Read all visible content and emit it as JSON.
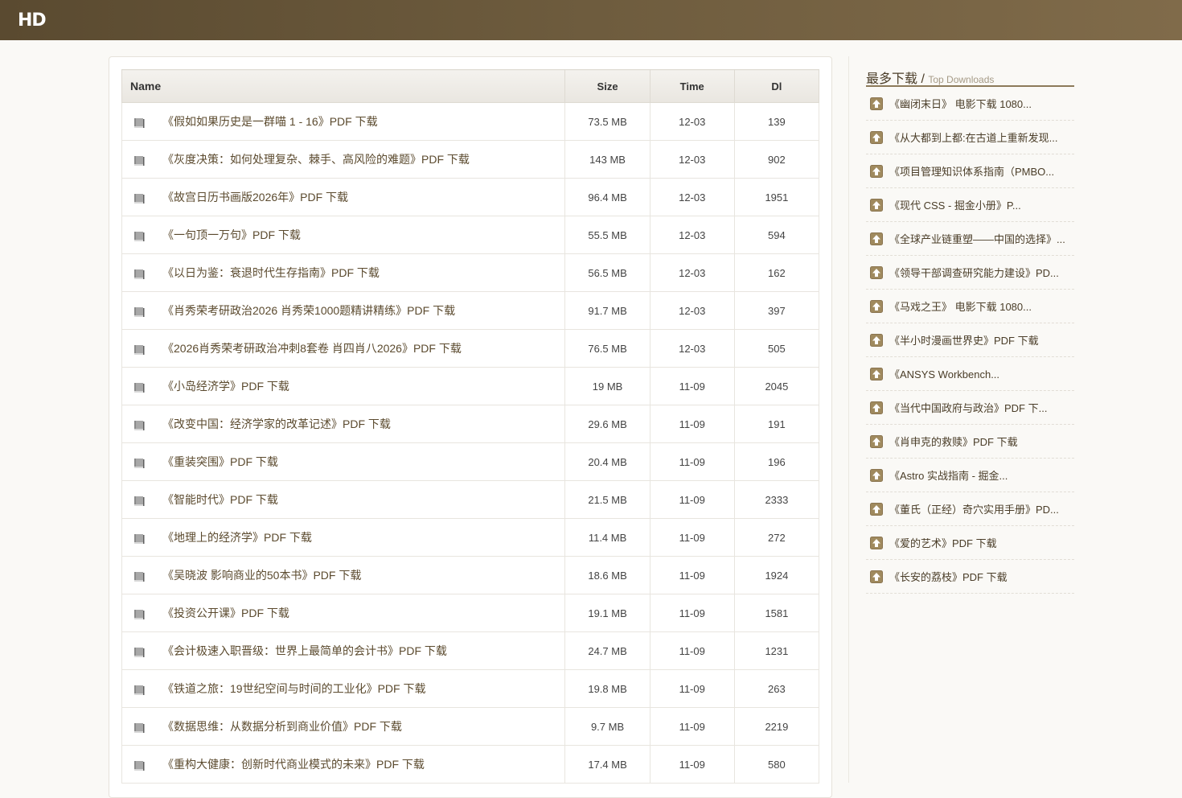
{
  "header": {
    "logo": "HD"
  },
  "table": {
    "columns": {
      "name": "Name",
      "size": "Size",
      "time": "Time",
      "dl": "Dl"
    },
    "rows": [
      {
        "name": "《假如如果历史是一群喵 1 - 16》PDF 下载",
        "size": "73.5 MB",
        "time": "12-03",
        "dl": "139"
      },
      {
        "name": "《灰度决策：如何处理复杂、棘手、高风险的难题》PDF 下载",
        "size": "143 MB",
        "time": "12-03",
        "dl": "902"
      },
      {
        "name": "《故宫日历书画版2026年》PDF 下载",
        "size": "96.4 MB",
        "time": "12-03",
        "dl": "1951"
      },
      {
        "name": "《一句顶一万句》PDF 下载",
        "size": "55.5 MB",
        "time": "12-03",
        "dl": "594"
      },
      {
        "name": "《以日为鉴：衰退时代生存指南》PDF 下载",
        "size": "56.5 MB",
        "time": "12-03",
        "dl": "162"
      },
      {
        "name": "《肖秀荣考研政治2026 肖秀荣1000题精讲精练》PDF 下载",
        "size": "91.7 MB",
        "time": "12-03",
        "dl": "397"
      },
      {
        "name": "《2026肖秀荣考研政治冲刺8套卷 肖四肖八2026》PDF 下载",
        "size": "76.5 MB",
        "time": "12-03",
        "dl": "505"
      },
      {
        "name": "《小岛经济学》PDF 下载",
        "size": "19 MB",
        "time": "11-09",
        "dl": "2045"
      },
      {
        "name": "《改变中国：经济学家的改革记述》PDF 下载",
        "size": "29.6 MB",
        "time": "11-09",
        "dl": "191"
      },
      {
        "name": "《重装突围》PDF 下载",
        "size": "20.4 MB",
        "time": "11-09",
        "dl": "196"
      },
      {
        "name": "《智能时代》PDF 下载",
        "size": "21.5 MB",
        "time": "11-09",
        "dl": "2333"
      },
      {
        "name": "《地理上的经济学》PDF 下载",
        "size": "11.4 MB",
        "time": "11-09",
        "dl": "272"
      },
      {
        "name": "《吴晓波 影响商业的50本书》PDF 下载",
        "size": "18.6 MB",
        "time": "11-09",
        "dl": "1924"
      },
      {
        "name": "《投资公开课》PDF 下载",
        "size": "19.1 MB",
        "time": "11-09",
        "dl": "1581"
      },
      {
        "name": "《会计极速入职晋级：世界上最简单的会计书》PDF 下载",
        "size": "24.7 MB",
        "time": "11-09",
        "dl": "1231"
      },
      {
        "name": "《铁道之旅：19世纪空间与时间的工业化》PDF 下载",
        "size": "19.8 MB",
        "time": "11-09",
        "dl": "263"
      },
      {
        "name": "《数据思维：从数据分析到商业价值》PDF 下载",
        "size": "9.7 MB",
        "time": "11-09",
        "dl": "2219"
      },
      {
        "name": "《重构大健康：创新时代商业模式的未来》PDF 下载",
        "size": "17.4 MB",
        "time": "11-09",
        "dl": "580"
      }
    ]
  },
  "sidebar": {
    "title_zh": "最多下载 / ",
    "title_en": "Top Downloads",
    "items": [
      "《幽闭末日》 电影下载 1080...",
      "《从大都到上都:在古道上重新发现...",
      "《项目管理知识体系指南（PMBO...",
      "《现代 CSS - 掘金小册》P...",
      "《全球产业链重塑——中国的选择》...",
      "《领导干部调查研究能力建设》PD...",
      "《马戏之王》 电影下载 1080...",
      "《半小时漫画世界史》PDF 下载",
      "《ANSYS Workbench...",
      "《当代中国政府与政治》PDF 下...",
      "《肖申克的救赎》PDF 下载",
      "《Astro 实战指南 - 掘金...",
      "《董氏（正经）奇穴实用手册》PD...",
      "《爱的艺术》PDF 下载",
      "《长安的荔枝》PDF 下载"
    ]
  },
  "colors": {
    "accent": "#6e5c3e",
    "download_count": "#2e9a5a",
    "link": "#5b4a2e"
  },
  "icons": {
    "file": "book-icon",
    "sidebar": "upload-arrow-icon"
  }
}
